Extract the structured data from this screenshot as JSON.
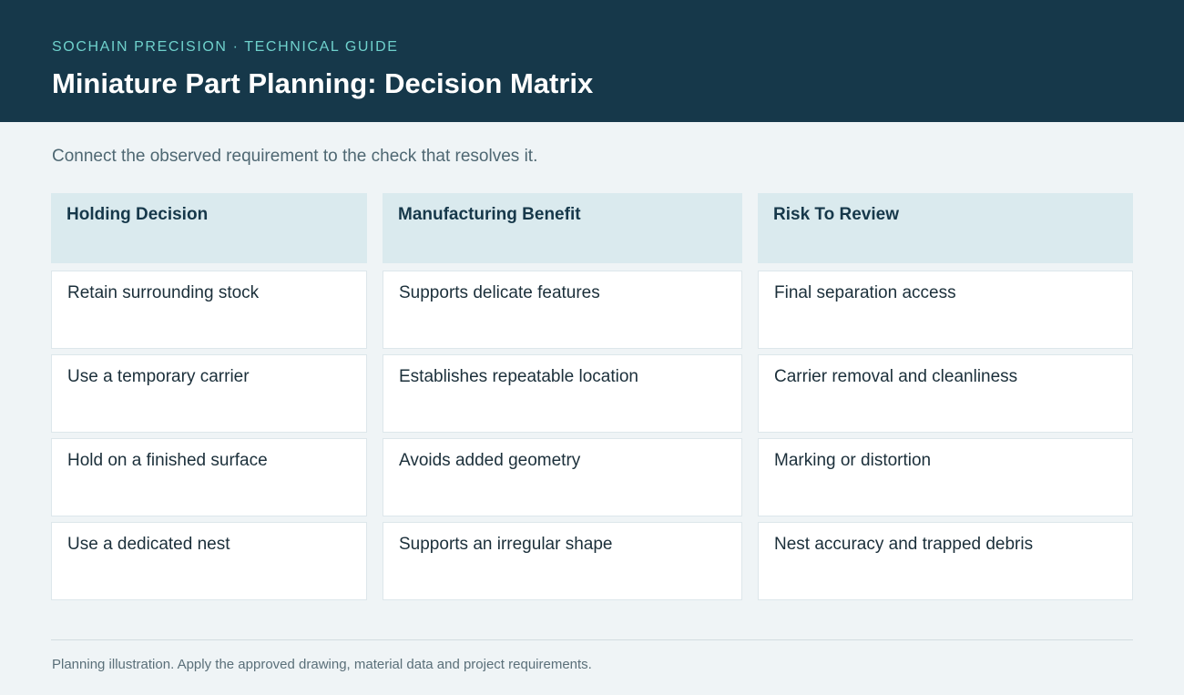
{
  "header": {
    "eyebrow": "SOCHAIN PRECISION · TECHNICAL GUIDE",
    "title": "Miniature Part Planning: Decision Matrix"
  },
  "intro": "Connect the observed requirement to the check that resolves it.",
  "matrix": {
    "columns": [
      "Holding Decision",
      "Manufacturing Benefit",
      "Risk To Review"
    ],
    "rows": [
      [
        "Retain surrounding stock",
        "Supports delicate features",
        "Final separation access"
      ],
      [
        "Use a temporary carrier",
        "Establishes repeatable location",
        "Carrier removal and cleanliness"
      ],
      [
        "Hold on a finished surface",
        "Avoids added geometry",
        "Marking or distortion"
      ],
      [
        "Use a dedicated nest",
        "Supports an irregular shape",
        "Nest accuracy and trapped debris"
      ]
    ]
  },
  "footnote": "Planning illustration. Apply the approved drawing, material data and project requirements.",
  "colors": {
    "header_bg": "#16384a",
    "accent": "#6fd1cc",
    "page_bg": "#eff4f6",
    "column_header_bg": "#daeaee"
  }
}
